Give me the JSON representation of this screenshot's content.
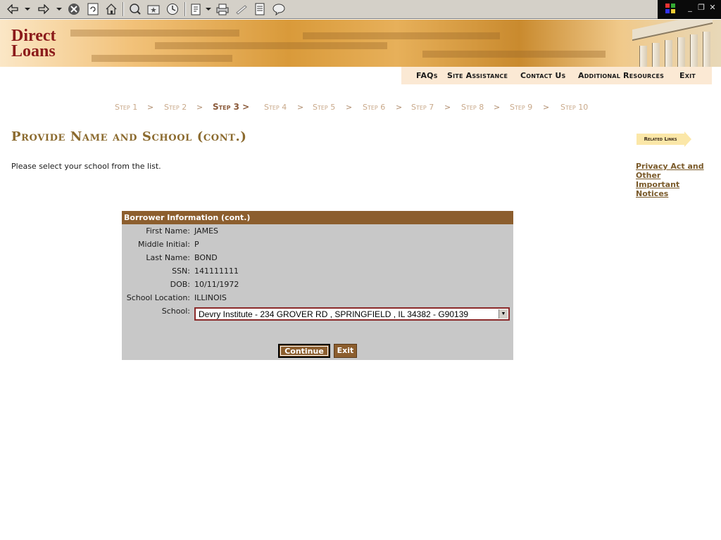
{
  "toolbar": {
    "icons": [
      "back-icon",
      "back-dropdown-icon",
      "forward-icon",
      "forward-dropdown-icon",
      "stop-icon",
      "refresh-icon",
      "home-icon",
      "search-icon",
      "favorites-icon",
      "history-icon",
      "edit-icon",
      "edit-dropdown-icon",
      "print-icon",
      "discuss-icon",
      "messenger-icon",
      "related-icon"
    ]
  },
  "banner": {
    "logo_line1": "Direct",
    "logo_line2": "Loans"
  },
  "topnav": {
    "faqs": "FAQs",
    "site_assistance": "Site Assistance",
    "contact_us": "Contact Us",
    "additional_resources": "Additional Resources",
    "exit": "Exit"
  },
  "steps": [
    "Step 1",
    "Step 2",
    "Step 3 >",
    "Step 4",
    "Step 5",
    "Step 6",
    "Step 7",
    "Step 8",
    "Step 9",
    "Step 10"
  ],
  "step_separator": ">",
  "page": {
    "title": "Provide Name and School (cont.)",
    "instruction": "Please select your school from the list."
  },
  "related": {
    "tag": "Related Links",
    "link": "Privacy Act and Other Important Notices"
  },
  "form": {
    "header": "Borrower Information (cont.)",
    "fields": [
      {
        "label": "First Name:",
        "value": "JAMES"
      },
      {
        "label": "Middle Initial:",
        "value": "P"
      },
      {
        "label": "Last Name:",
        "value": "BOND"
      },
      {
        "label": "SSN:",
        "value": "141111111"
      },
      {
        "label": "DOB:",
        "value": "10/11/1972"
      },
      {
        "label": "School Location:",
        "value": "ILLINOIS"
      }
    ],
    "school_label": "School:",
    "school_selected": "Devry Institute - 234 GROVER RD , SPRINGFIELD , IL 34382 - G90139",
    "continue_label": "Continue",
    "exit_label": "Exit"
  },
  "colors": {
    "accent": "#8c5e2e",
    "title": "#8b6a2e",
    "logo": "#8b1a1a",
    "panel": "#c8c8c8"
  }
}
